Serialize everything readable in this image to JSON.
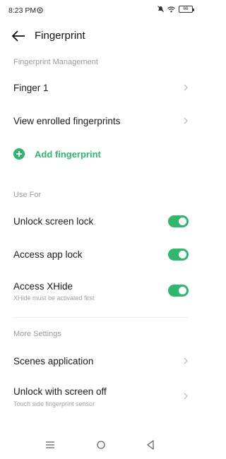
{
  "status_bar": {
    "time": "8:23 PM",
    "battery": "66"
  },
  "header": {
    "title": "Fingerprint"
  },
  "sections": {
    "management_title": "Fingerprint Management",
    "use_for_title": "Use For",
    "more_settings_title": "More Settings"
  },
  "management": {
    "finger_1": "Finger 1",
    "view_enrolled": "View enrolled fingerprints",
    "add_fingerprint": "Add fingerprint"
  },
  "use_for": {
    "unlock_screen_lock": {
      "label": "Unlock screen lock",
      "enabled": true
    },
    "access_app_lock": {
      "label": "Access app lock",
      "enabled": true
    },
    "access_xhide": {
      "label": "Access XHide",
      "sublabel": "XHide must be activated first",
      "enabled": true
    }
  },
  "more_settings": {
    "scenes_application": "Scenes application",
    "unlock_screen_off": {
      "label": "Unlock with screen off",
      "sublabel": "Touch side fingerprint sensor"
    }
  },
  "colors": {
    "accent": "#2db86b",
    "section_title": "#9a9a9a"
  }
}
